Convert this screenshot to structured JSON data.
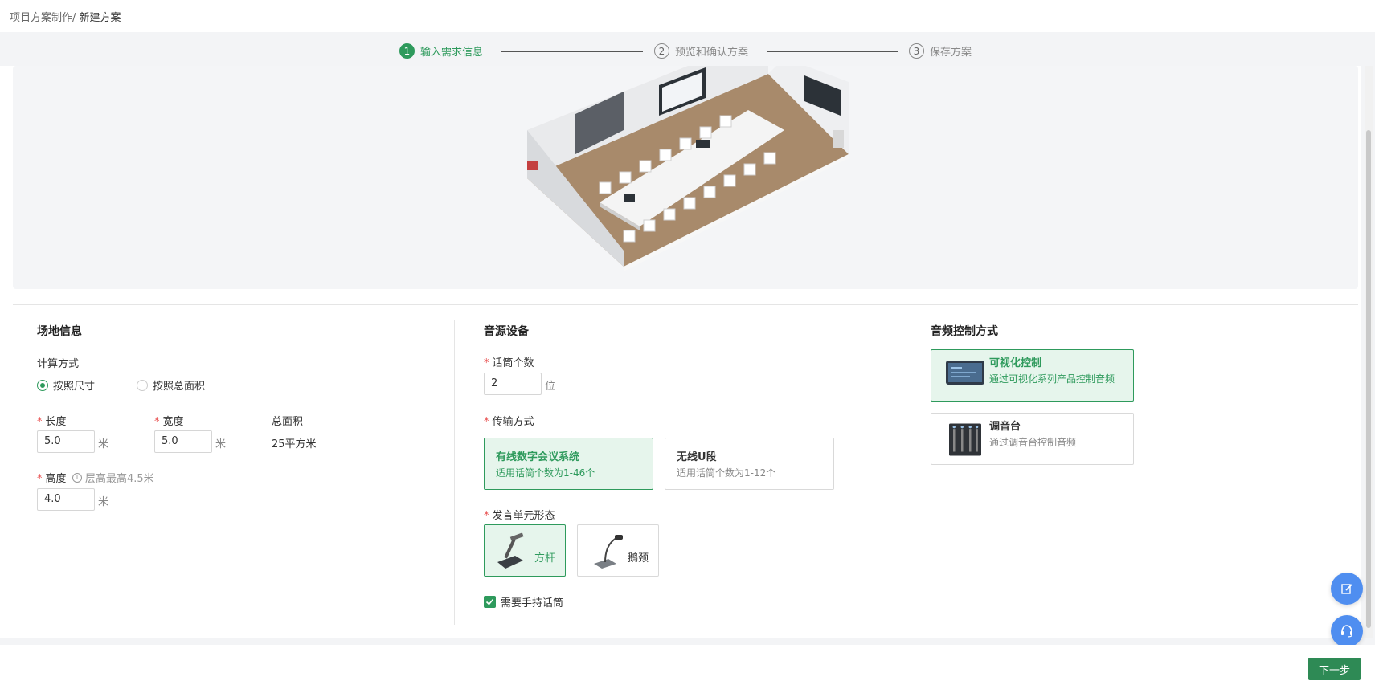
{
  "breadcrumb": {
    "parent": "项目方案制作/",
    "current": " 新建方案"
  },
  "steps": [
    {
      "num": "1",
      "label": "输入需求信息"
    },
    {
      "num": "2",
      "label": "预览和确认方案"
    },
    {
      "num": "3",
      "label": "保存方案"
    }
  ],
  "venue": {
    "title": "场地信息",
    "calc_label": "计算方式",
    "calc_options": [
      "按照尺寸",
      "按照总面积"
    ],
    "length_label": "长度",
    "length_value": "5.0",
    "width_label": "宽度",
    "width_value": "5.0",
    "area_label": "总面积",
    "area_value": "25平方米",
    "height_label": "高度",
    "height_hint": "层高最高4.5米",
    "height_value": "4.0",
    "unit": "米"
  },
  "audio": {
    "title": "音源设备",
    "mic_count_label": "话筒个数",
    "mic_count_value": "2",
    "mic_unit": "位",
    "transport_label": "传输方式",
    "transport_options": [
      {
        "title": "有线数字会议系统",
        "desc": "适用话筒个数为1-46个"
      },
      {
        "title": "无线U段",
        "desc": "适用话筒个数为1-12个"
      }
    ],
    "unit_form_label": "发言单元形态",
    "unit_forms": [
      "方杆",
      "鹅颈"
    ],
    "handheld_label": "需要手持话筒"
  },
  "control": {
    "title": "音频控制方式",
    "options": [
      {
        "title": "可视化控制",
        "desc": "通过可视化系列产品控制音频"
      },
      {
        "title": "调音台",
        "desc": "通过调音台控制音频"
      }
    ]
  },
  "footer": {
    "next_label": "下一步"
  },
  "colors": {
    "accent": "#2e9a5c",
    "fab": "#4f8ef0"
  },
  "icons": [
    "edit-icon",
    "headset-icon",
    "info-icon",
    "check-icon"
  ]
}
